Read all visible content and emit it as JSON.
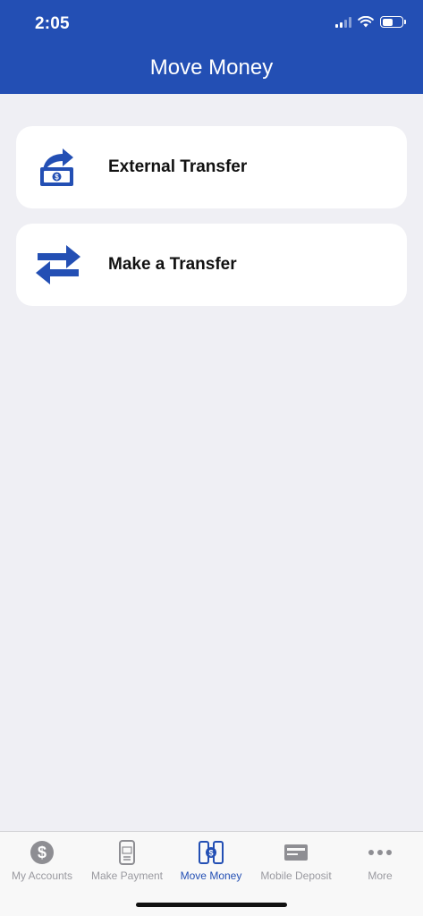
{
  "status_bar": {
    "time": "2:05"
  },
  "header": {
    "title": "Move Money"
  },
  "actions": [
    {
      "label": "External Transfer",
      "icon": "external-transfer-icon"
    },
    {
      "label": "Make a Transfer",
      "icon": "transfer-arrows-icon"
    }
  ],
  "tabbar": {
    "items": [
      {
        "label": "My Accounts",
        "icon": "dollar-circle-icon"
      },
      {
        "label": "Make Payment",
        "icon": "pay-phone-icon"
      },
      {
        "label": "Move Money",
        "icon": "move-money-icon",
        "active": true
      },
      {
        "label": "Mobile Deposit",
        "icon": "check-deposit-icon"
      },
      {
        "label": "More",
        "icon": "more-dots-icon"
      }
    ]
  },
  "colors": {
    "brand": "#234fb4",
    "inactive_tab": "#9a9aa0",
    "background": "#efeff4"
  }
}
